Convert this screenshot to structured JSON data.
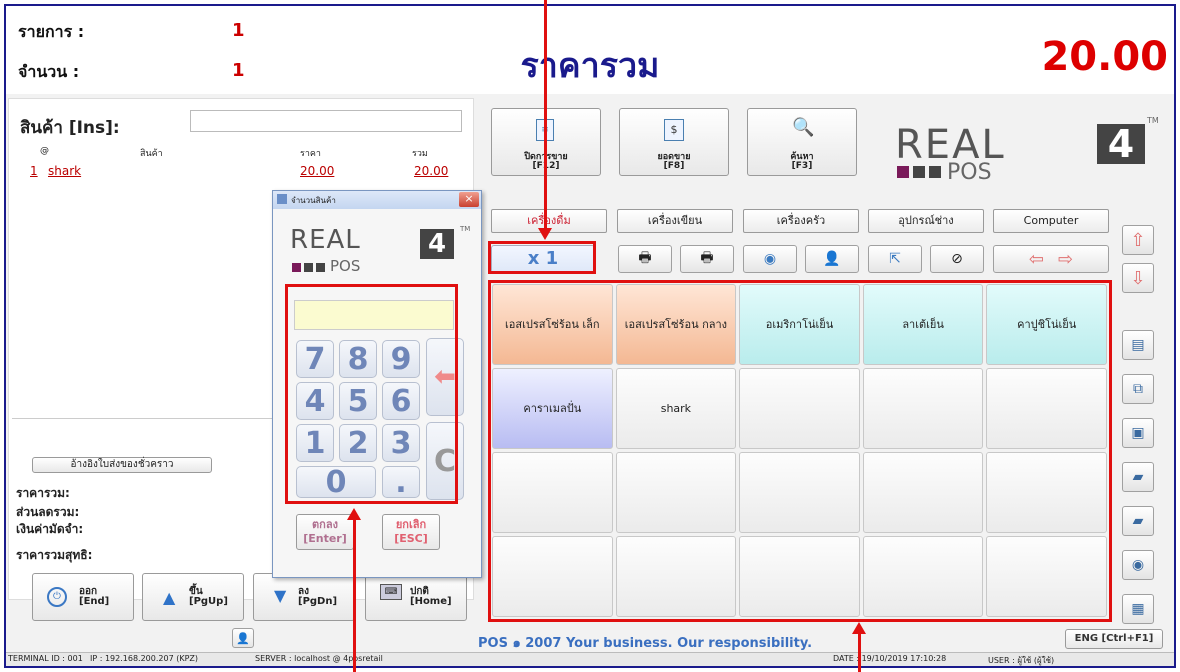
{
  "header": {
    "items_label": "รายการ :",
    "items_value": "1",
    "qty_label": "จำนวน :",
    "qty_value": "1",
    "title": "ราคารวม",
    "total": "20.00"
  },
  "left": {
    "product_label": "สินค้า [Ins]:",
    "columns": [
      "@",
      "สินค้า",
      "ราคา",
      "รวม"
    ],
    "rows": [
      {
        "no": "1",
        "name": "shark",
        "price": "20.00",
        "total": "20.00"
      }
    ],
    "ref_button": "อ้างอิงใบส่งของชั่วคราว",
    "summary": [
      "ราคารวม:",
      "ส่วนลดรวม:",
      "เงินค่ามัดจำ:",
      "ราคารวมสุทธิ:"
    ]
  },
  "bottom_buttons": [
    {
      "label": "ออก",
      "key": "[End]",
      "icon": "power-icon"
    },
    {
      "label": "ขึ้น",
      "key": "[PgUp]",
      "icon": "arrow-up-icon"
    },
    {
      "label": "ลง",
      "key": "[PgDn]",
      "icon": "arrow-down-icon"
    },
    {
      "label": "ปกติ",
      "key": "[Home]",
      "icon": "keyboard-icon"
    }
  ],
  "func_buttons": [
    {
      "label": "ปิดการขาย",
      "key": "[F12]",
      "icon": "receipt-icon"
    },
    {
      "label": "ยอดขาย",
      "key": "[F8]",
      "icon": "dollar-icon"
    },
    {
      "label": "ค้นหา",
      "key": "[F3]",
      "icon": "magnifier-icon"
    }
  ],
  "logo": {
    "text": "REAL",
    "number": "4",
    "sub": "POS",
    "tm": "TM"
  },
  "categories": [
    "เครื่องดื่ม",
    "เครื่องเขียน",
    "เครื่องครัว",
    "อุปกรณ์ช่าง",
    "Computer"
  ],
  "multiplier": "x 1",
  "products": [
    {
      "name": "เอสเปรสโซ่ร้อน เล็ก",
      "style": "orange"
    },
    {
      "name": "เอสเปรสโซ่ร้อน กลาง",
      "style": "orange"
    },
    {
      "name": "อเมริกาโน่เย็น",
      "style": "cyan"
    },
    {
      "name": "ลาเต้เย็น",
      "style": "cyan"
    },
    {
      "name": "คาปูชิโน่เย็น",
      "style": "cyan"
    },
    {
      "name": "คาราเมลปั่น",
      "style": "lav"
    },
    {
      "name": "shark",
      "style": "wht"
    },
    {
      "name": "",
      "style": "wht"
    },
    {
      "name": "",
      "style": "wht"
    },
    {
      "name": "",
      "style": "wht"
    },
    {
      "name": "",
      "style": "wht"
    },
    {
      "name": "",
      "style": "wht"
    },
    {
      "name": "",
      "style": "wht"
    },
    {
      "name": "",
      "style": "wht"
    },
    {
      "name": "",
      "style": "wht"
    },
    {
      "name": "",
      "style": "wht"
    },
    {
      "name": "",
      "style": "wht"
    },
    {
      "name": "",
      "style": "wht"
    },
    {
      "name": "",
      "style": "wht"
    },
    {
      "name": "",
      "style": "wht"
    }
  ],
  "dialog": {
    "title": "จำนวนสินค้า",
    "ok": "ตกลง",
    "ok_key": "[Enter]",
    "cancel": "ยกเลิก",
    "cancel_key": "[ESC]",
    "keys": [
      "7",
      "8",
      "9",
      "4",
      "5",
      "6",
      "1",
      "2",
      "3",
      "0",
      "."
    ],
    "clear": "C"
  },
  "footer": {
    "copyright": "POS ๑ 2007 Your business. Our responsibility.",
    "lang": "ENG [Ctrl+F1]"
  },
  "status": {
    "terminal": "TERMINAL ID : 001",
    "ip": "IP : 192.168.200.207 (KPZ)",
    "server": "SERVER : localhost @ 4posretail",
    "date": "DATE : 19/10/2019 17:10:28",
    "user": "USER : ผู้ใช้ (ผู้ใช้)"
  }
}
